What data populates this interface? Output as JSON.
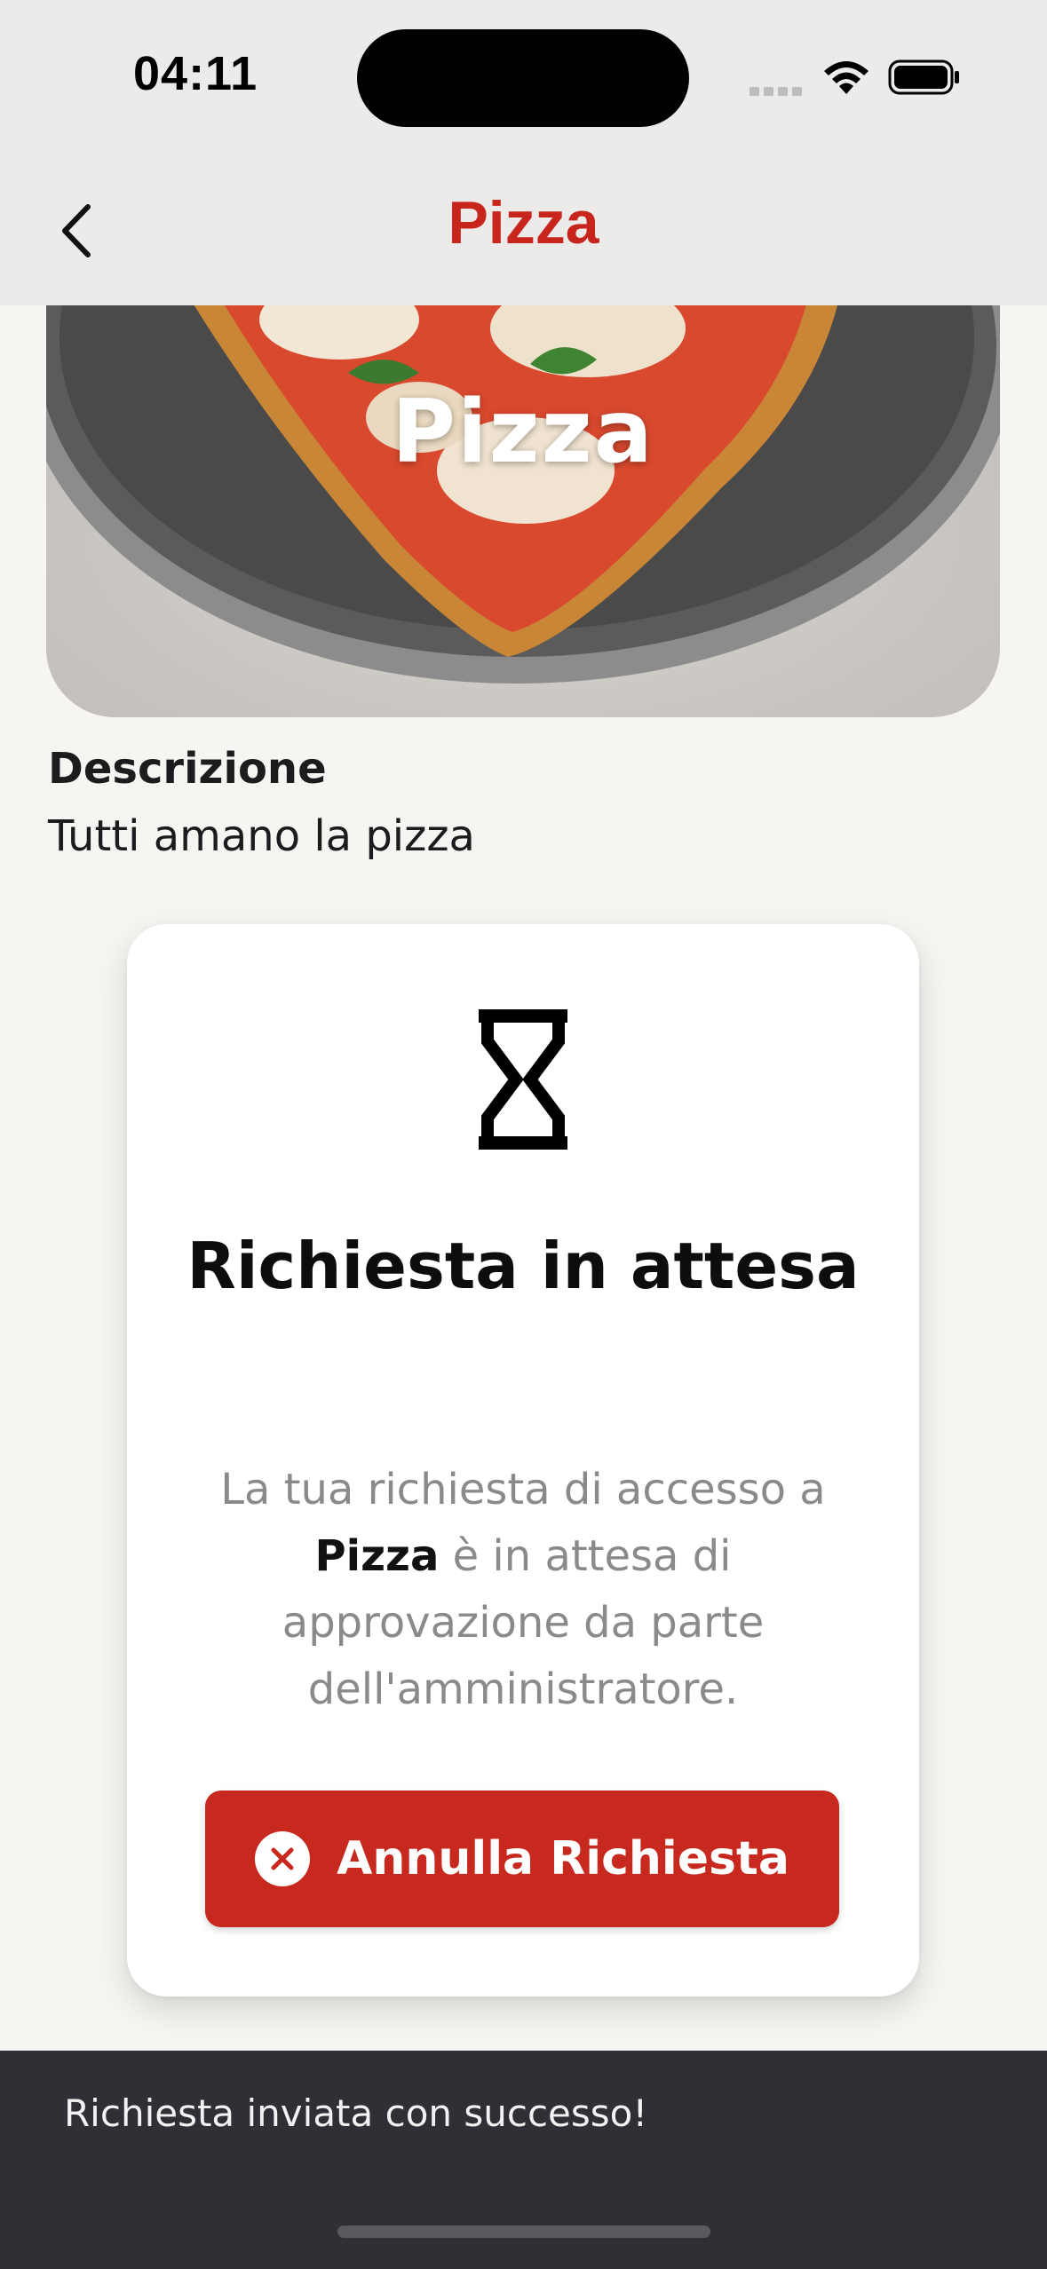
{
  "status_bar": {
    "time": "04:11"
  },
  "nav": {
    "title": "Pizza",
    "back_icon": "chevron-left-icon"
  },
  "hero": {
    "title": "Pizza"
  },
  "description": {
    "label": "Descrizione",
    "text": "Tutti amano la pizza"
  },
  "pending_card": {
    "icon": "hourglass-icon",
    "title": "Richiesta in attesa",
    "message_before": "La tua richiesta di accesso a ",
    "message_bold": "Pizza",
    "message_after": " è in attesa di approvazione da parte dell'amministratore.",
    "cancel_label": "Annulla Richiesta",
    "cancel_icon": "close-circle-icon"
  },
  "snackbar": {
    "text": "Richiesta inviata con successo!"
  },
  "colors": {
    "accent": "#c8261c",
    "snackbar_bg": "#302f35",
    "header_bg": "#edeaea"
  }
}
